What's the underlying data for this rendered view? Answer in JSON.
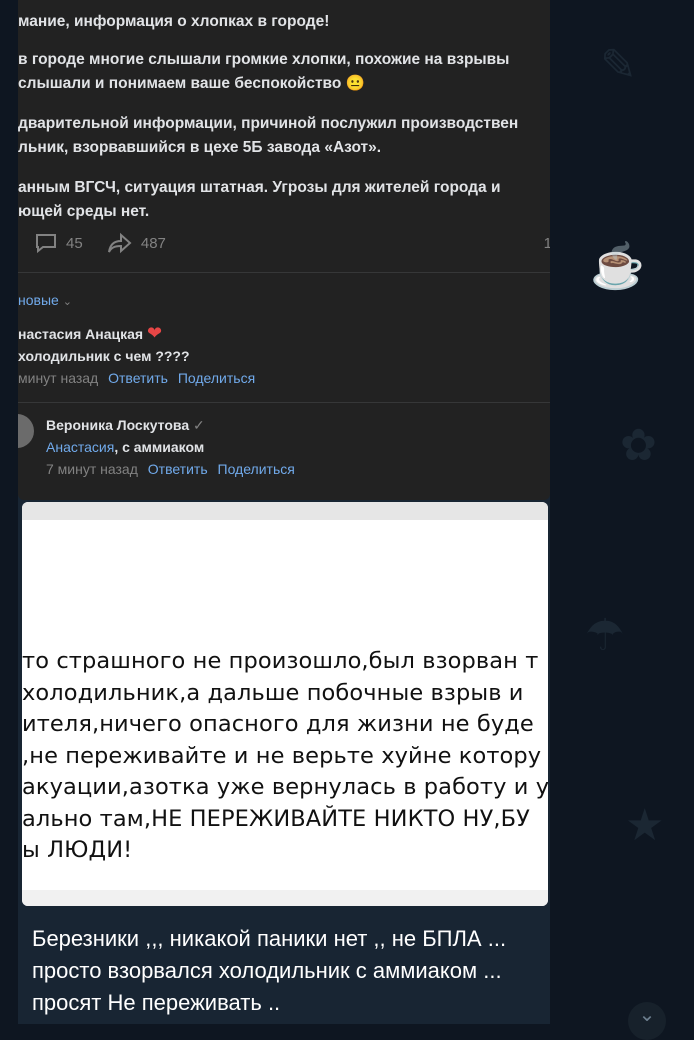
{
  "post": {
    "lines": [
      "мание, информация о хлопках в городе!",
      "в городе многие слышали громкие хлопки, похожие на взрывы",
      " слышали и понимаем ваше беспокойство 😐",
      "дварительной информации, причиной послужил производствен",
      "льник, взорвавшийся в цехе 5Б завода «Азот».",
      "анным ВГСЧ, ситуация штатная. Угрозы для жителей города и",
      "ющей среды нет."
    ],
    "comments_count": "45",
    "shares_count": "487",
    "views_partial": "1"
  },
  "new_link": "новые",
  "comments": [
    {
      "author": "настасия Анацкая",
      "text": "холодильник с чем ????",
      "time": "минут назад",
      "reply": "Ответить",
      "share": "Поделиться"
    },
    {
      "author": "Вероника Лоскутова",
      "mention": "Анастасия",
      "text": ", с аммиаком",
      "time": "7 минут назад",
      "reply": "Ответить",
      "share": "Поделиться"
    }
  ],
  "photo_lines": [
    "то страшного не произошло,был взорван т",
    " холодильник,а дальше побочные взрыв и",
    "ителя,ничего опасного для жизни не буде",
    ",не переживайте и не верьте хуйне котору",
    "акуации,азотка уже вернулась в работу и у",
    "ально там,НЕ ПЕРЕЖИВАЙТЕ НИКТО НУ,БУ",
    "ы ЛЮДИ!"
  ],
  "caption": "Березники ,,, никакой паники нет ,, не БПЛА  ... просто взорвался холодильник с аммиаком  ...  просят Не переживать ..",
  "colors": {
    "accent": "#71aaeb",
    "bubble": "#182533",
    "background": "#0e1621"
  }
}
